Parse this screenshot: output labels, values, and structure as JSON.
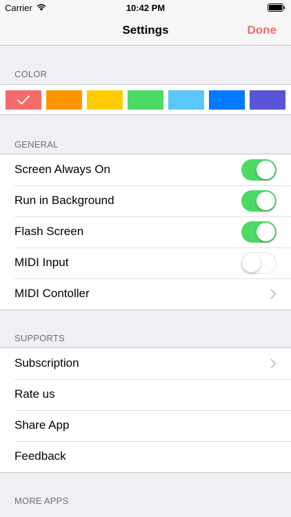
{
  "status_bar": {
    "carrier": "Carrier",
    "time": "10:42 PM"
  },
  "nav": {
    "title": "Settings",
    "done_label": "Done",
    "done_color": "#f46b6b"
  },
  "sections": {
    "color": "COLOR",
    "general": "GENERAL",
    "supports": "SUPPORTS",
    "more_apps": "MORE APPS"
  },
  "colors": {
    "selected_index": 0,
    "swatches": [
      "#f46b6b",
      "#ff9500",
      "#ffcc00",
      "#4cd964",
      "#5ac8fa",
      "#007aff",
      "#5856d6"
    ]
  },
  "general": [
    {
      "label": "Screen Always On",
      "control": "toggle",
      "on": true
    },
    {
      "label": "Run in Background",
      "control": "toggle",
      "on": true
    },
    {
      "label": "Flash Screen",
      "control": "toggle",
      "on": true
    },
    {
      "label": "MIDI Input",
      "control": "toggle",
      "on": false
    },
    {
      "label": "MIDI Contoller",
      "control": "chevron"
    }
  ],
  "supports": [
    {
      "label": "Subscription",
      "control": "chevron"
    },
    {
      "label": "Rate us"
    },
    {
      "label": "Share App"
    },
    {
      "label": "Feedback"
    }
  ],
  "icons": {
    "wifi": "wifi-icon",
    "battery": "battery-icon",
    "check": "checkmark-icon",
    "chevron": "chevron-right-icon"
  }
}
